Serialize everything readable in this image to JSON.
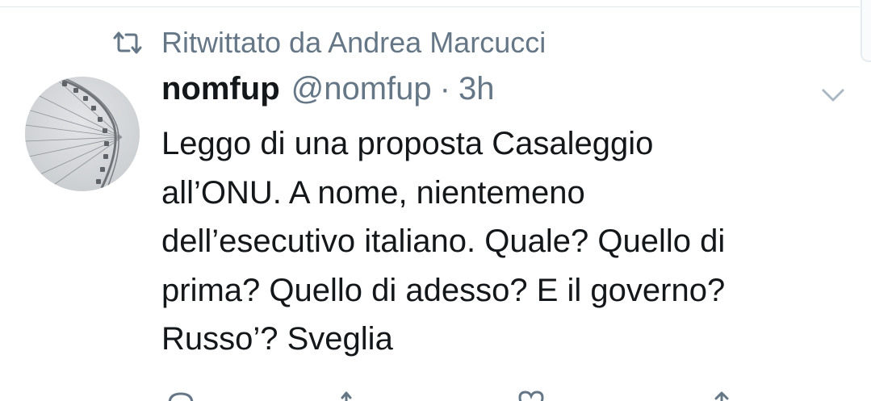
{
  "retweet_banner": {
    "icon": "retweet-icon",
    "text": "Ritwittato da Andrea Marcucci"
  },
  "tweet": {
    "avatar_icon": "ferris-wheel-avatar",
    "display_name": "nomfup",
    "handle": "@nomfup",
    "separator": "·",
    "time": "3h",
    "menu_icon": "chevron-down-icon",
    "text": "Leggo di una proposta Casaleggio\nall’ONU. A nome, nientemeno\ndell’esecutivo italiano. Quale? Quello di\nprima? Quello di adesso? E il governo?\nRusso’? Sveglia"
  },
  "actions": [
    "reply-icon",
    "retweet-icon",
    "like-icon",
    "share-icon"
  ],
  "colors": {
    "text_primary": "#14171a",
    "text_secondary": "#657786",
    "divider": "#e1e8ed"
  }
}
